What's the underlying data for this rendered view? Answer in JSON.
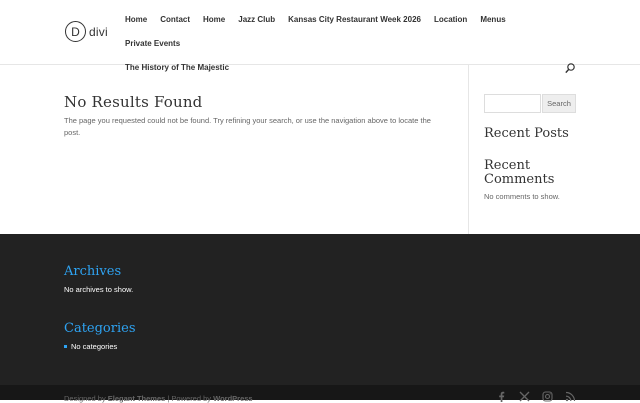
{
  "logo": {
    "letter": "D",
    "text": "divi"
  },
  "nav": {
    "row1": [
      "Home",
      "Contact",
      "Home",
      "Jazz Club",
      "Kansas City Restaurant Week 2026",
      "Location",
      "Menus",
      "Private Events"
    ],
    "row2": [
      "The History of The Majestic"
    ]
  },
  "icons": {
    "search": "search-icon",
    "facebook": "facebook-icon",
    "x": "x-icon",
    "instagram": "instagram-icon",
    "rss": "rss-icon"
  },
  "content": {
    "title": "No Results Found",
    "text": "The page you requested could not be found. Try refining your search, or use the navigation above to locate the post."
  },
  "sidebar": {
    "search": {
      "placeholder": "",
      "button": "Search"
    },
    "recent_posts_title": "Recent Posts",
    "recent_comments_title": "Recent Comments",
    "recent_comments_text": "No comments to show."
  },
  "footer": {
    "archives_title": "Archives",
    "archives_text": "No archives to show.",
    "categories_title": "Categories",
    "categories_items": [
      "No categories"
    ]
  },
  "credits": {
    "prefix": "Designed by ",
    "elegant": "Elegant Themes",
    "separator": " | Powered by ",
    "wordpress": "WordPress"
  },
  "colors": {
    "accent": "#2ea3f2",
    "footer_bg": "#222222",
    "bottom_bar_bg": "#171717"
  }
}
